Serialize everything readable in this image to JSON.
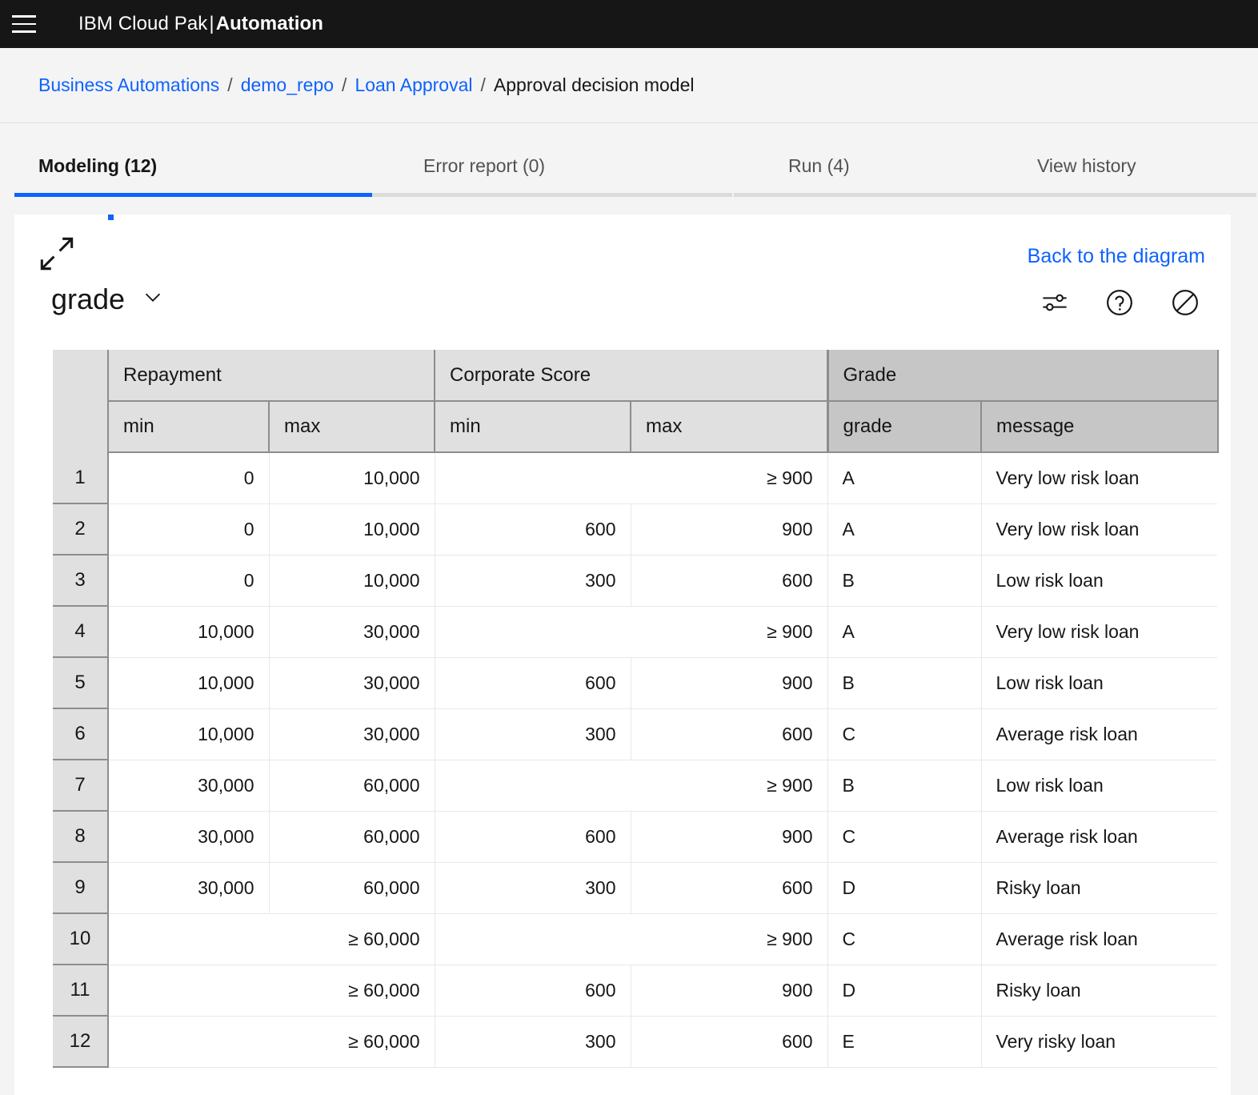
{
  "header": {
    "menu_icon": "hamburger-icon",
    "brand_prefix": "IBM Cloud Pak",
    "brand_sep": "|",
    "brand_suffix": "Automation"
  },
  "breadcrumb": {
    "items": [
      {
        "label": "Business Automations",
        "link": true
      },
      {
        "label": "demo_repo",
        "link": true
      },
      {
        "label": "Loan Approval",
        "link": true
      },
      {
        "label": "Approval decision model",
        "link": false
      }
    ],
    "separator": "/"
  },
  "tabs": [
    {
      "label": "Modeling (12)",
      "selected": true
    },
    {
      "label": "Error report (0)",
      "selected": false
    },
    {
      "label": "Run (4)",
      "selected": false
    },
    {
      "label": "View history",
      "selected": false
    }
  ],
  "panel": {
    "expand_icon": "expand-diagonal-icon",
    "back_link": "Back to the diagram",
    "title": "grade",
    "title_caret_icon": "chevron-down-icon",
    "tool_icons": [
      {
        "name": "settings-sliders-icon"
      },
      {
        "name": "help-circle-icon"
      },
      {
        "name": "disable-circle-slash-icon"
      }
    ]
  },
  "colors": {
    "accent_blue": "#0f62fe",
    "header_bar": "#161616",
    "input_header_bg": "#e0e0e0",
    "output_header_bg": "#c6c6c6",
    "page_bg": "#f4f4f4"
  },
  "chart_data": {
    "type": "table",
    "title": "grade",
    "groups": [
      {
        "label": "Repayment",
        "kind": "input",
        "subcolumns": [
          "min",
          "max"
        ],
        "sort_icon": "sort-updown-icon"
      },
      {
        "label": "Corporate Score",
        "kind": "input",
        "subcolumns": [
          "min",
          "max"
        ],
        "sort_icon": "sort-updown-icon"
      },
      {
        "label": "Grade",
        "kind": "output",
        "subcolumns": [
          "grade",
          "message"
        ]
      }
    ],
    "row_header": "",
    "rows": [
      {
        "n": "1",
        "repayment_min": "0",
        "repayment_max": "10,000",
        "repayment_span": false,
        "score_min": "",
        "score_max": "≥ 900",
        "score_span": true,
        "grade": "A",
        "message": "Very low risk loan"
      },
      {
        "n": "2",
        "repayment_min": "0",
        "repayment_max": "10,000",
        "repayment_span": false,
        "score_min": "600",
        "score_max": "900",
        "score_span": false,
        "grade": "A",
        "message": "Very low risk loan"
      },
      {
        "n": "3",
        "repayment_min": "0",
        "repayment_max": "10,000",
        "repayment_span": false,
        "score_min": "300",
        "score_max": "600",
        "score_span": false,
        "grade": "B",
        "message": "Low risk loan"
      },
      {
        "n": "4",
        "repayment_min": "10,000",
        "repayment_max": "30,000",
        "repayment_span": false,
        "score_min": "",
        "score_max": "≥ 900",
        "score_span": true,
        "grade": "A",
        "message": "Very low risk loan"
      },
      {
        "n": "5",
        "repayment_min": "10,000",
        "repayment_max": "30,000",
        "repayment_span": false,
        "score_min": "600",
        "score_max": "900",
        "score_span": false,
        "grade": "B",
        "message": "Low risk loan"
      },
      {
        "n": "6",
        "repayment_min": "10,000",
        "repayment_max": "30,000",
        "repayment_span": false,
        "score_min": "300",
        "score_max": "600",
        "score_span": false,
        "grade": "C",
        "message": "Average risk loan"
      },
      {
        "n": "7",
        "repayment_min": "30,000",
        "repayment_max": "60,000",
        "repayment_span": false,
        "score_min": "",
        "score_max": "≥ 900",
        "score_span": true,
        "grade": "B",
        "message": "Low risk loan"
      },
      {
        "n": "8",
        "repayment_min": "30,000",
        "repayment_max": "60,000",
        "repayment_span": false,
        "score_min": "600",
        "score_max": "900",
        "score_span": false,
        "grade": "C",
        "message": "Average risk loan"
      },
      {
        "n": "9",
        "repayment_min": "30,000",
        "repayment_max": "60,000",
        "repayment_span": false,
        "score_min": "300",
        "score_max": "600",
        "score_span": false,
        "grade": "D",
        "message": "Risky loan"
      },
      {
        "n": "10",
        "repayment_min": "",
        "repayment_max": "≥ 60,000",
        "repayment_span": true,
        "score_min": "",
        "score_max": "≥ 900",
        "score_span": true,
        "grade": "C",
        "message": "Average risk loan"
      },
      {
        "n": "11",
        "repayment_min": "",
        "repayment_max": "≥ 60,000",
        "repayment_span": true,
        "score_min": "600",
        "score_max": "900",
        "score_span": false,
        "grade": "D",
        "message": "Risky loan"
      },
      {
        "n": "12",
        "repayment_min": "",
        "repayment_max": "≥ 60,000",
        "repayment_span": true,
        "score_min": "300",
        "score_max": "600",
        "score_span": false,
        "grade": "E",
        "message": "Very risky loan"
      }
    ]
  }
}
